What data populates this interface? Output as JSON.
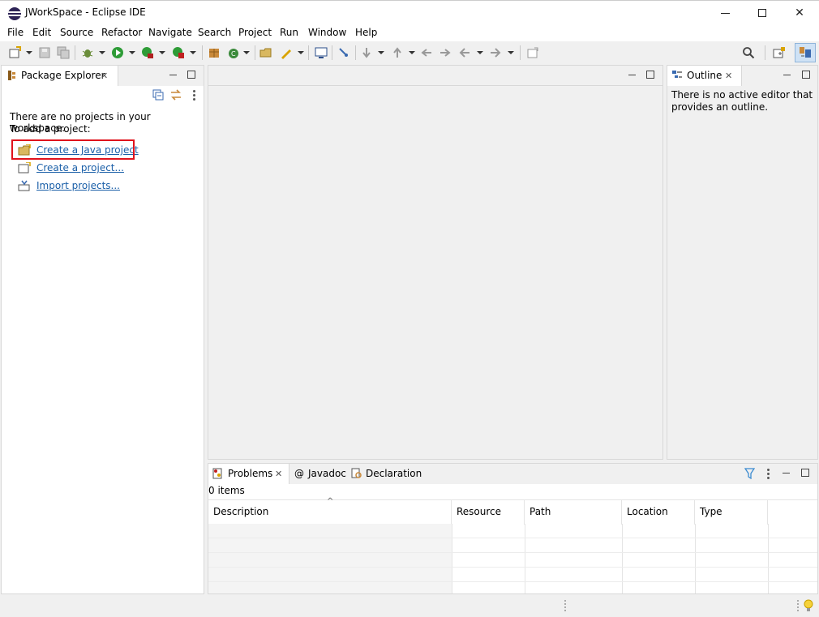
{
  "window": {
    "title": "JWorkSpace - Eclipse IDE"
  },
  "menu": [
    "File",
    "Edit",
    "Source",
    "Refactor",
    "Navigate",
    "Search",
    "Project",
    "Run",
    "Window",
    "Help"
  ],
  "package_explorer": {
    "tab_label": "Package Explorer",
    "message_line1": "There are no projects in your workspace.",
    "message_line2": "To add a project:",
    "links": [
      "Create a Java project",
      "Create a project...",
      "Import projects..."
    ]
  },
  "outline": {
    "tab_label": "Outline",
    "message_line1": "There is no active editor that",
    "message_line2": "provides an outline."
  },
  "bottom": {
    "tabs": [
      "Problems",
      "Javadoc",
      "Declaration"
    ],
    "item_count": "0 items",
    "columns": [
      "Description",
      "Resource",
      "Path",
      "Location",
      "Type"
    ]
  },
  "colors": {
    "highlight": "#e0121c",
    "link": "#1a5fa8"
  },
  "icons": [
    "eclipse-icon",
    "new-icon",
    "save-icon",
    "save-all-icon",
    "debug-icon",
    "run-icon",
    "coverage-icon",
    "external-tools-icon",
    "new-java-package-icon",
    "new-java-class-icon",
    "open-type-icon",
    "search-icon",
    "open-perspective-icon",
    "java-perspective-icon",
    "lightbulb-icon"
  ]
}
